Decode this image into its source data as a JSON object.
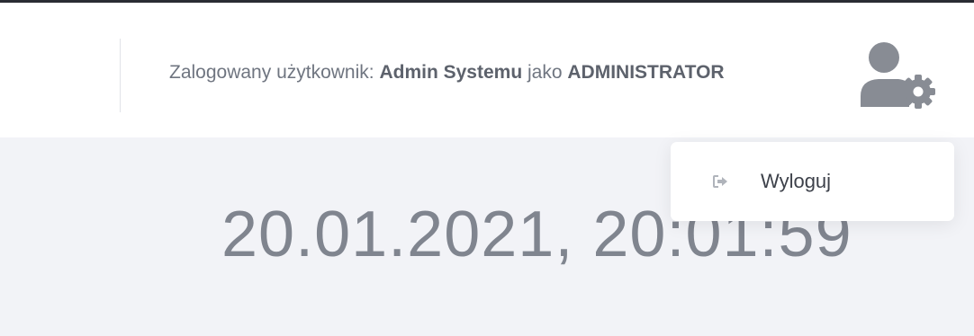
{
  "header": {
    "user_prefix": "Zalogowany użytkownik:",
    "user_name": "Admin Systemu",
    "role_connector": "jako",
    "role": "ADMINISTRATOR",
    "user_icon": "user-cog-icon"
  },
  "user_menu": {
    "items": [
      {
        "label": "Wyloguj",
        "icon": "sign-out-icon"
      }
    ]
  },
  "main": {
    "datetime": "20.01.2021, 20:01:59"
  },
  "colors": {
    "icon_gray": "#888c94",
    "text_gray": "#6f7580",
    "background": "#f2f3f7"
  }
}
